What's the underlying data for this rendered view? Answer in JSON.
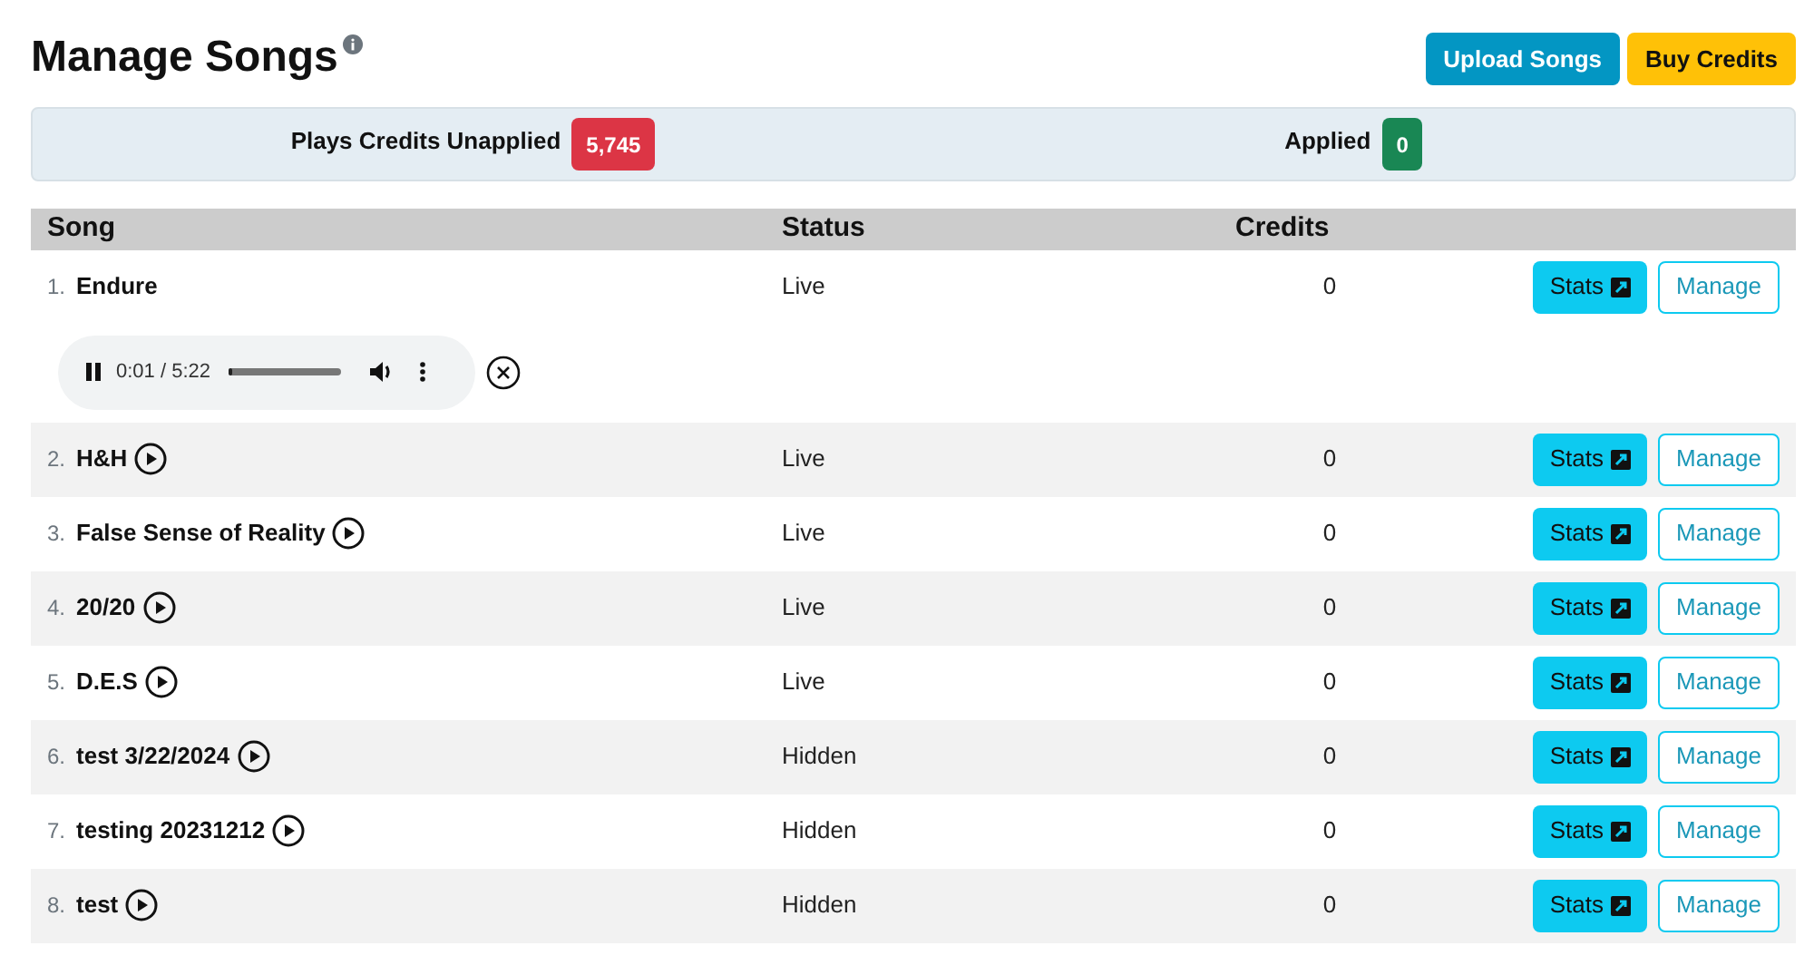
{
  "title": "Manage Songs",
  "buttons": [
    {
      "label": "Upload Songs",
      "kind": "primary"
    },
    {
      "label": "Buy Credits",
      "kind": "warning"
    }
  ],
  "summary": [
    {
      "label": "Plays Credits Unapplied",
      "value": "5,745",
      "color": "#dc3545"
    },
    {
      "label": "Applied",
      "value": "0",
      "color": "#198754"
    }
  ],
  "table": {
    "columns": [
      "Song",
      "Status",
      "Credits"
    ],
    "rows": [
      {
        "number": "1.",
        "song": "Endure",
        "status": "Live",
        "credits": "0",
        "playing": true,
        "player": {
          "time": "0:01 / 5:22",
          "level": 0.04
        },
        "stats": "Stats",
        "manage": "Manage"
      },
      {
        "number": "2.",
        "song": "H&H",
        "status": "Live",
        "credits": "0",
        "playing": false,
        "stats": "Stats",
        "manage": "Manage"
      },
      {
        "number": "3.",
        "song": "False Sense of Reality",
        "status": "Live",
        "credits": "0",
        "playing": false,
        "stats": "Stats",
        "manage": "Manage"
      },
      {
        "number": "4.",
        "song": "20/20",
        "status": "Live",
        "credits": "0",
        "playing": false,
        "stats": "Stats",
        "manage": "Manage"
      },
      {
        "number": "5.",
        "song": "D.E.S",
        "status": "Live",
        "credits": "0",
        "playing": false,
        "stats": "Stats",
        "manage": "Manage"
      },
      {
        "number": "6.",
        "song": "test 3/22/2024",
        "status": "Hidden",
        "credits": "0",
        "playing": false,
        "stats": "Stats",
        "manage": "Manage"
      },
      {
        "number": "7.",
        "song": "testing 20231212",
        "status": "Hidden",
        "credits": "0",
        "playing": false,
        "stats": "Stats",
        "manage": "Manage"
      },
      {
        "number": "8.",
        "song": "test",
        "status": "Hidden",
        "credits": "0",
        "playing": false,
        "stats": "Stats",
        "manage": "Manage"
      }
    ]
  }
}
